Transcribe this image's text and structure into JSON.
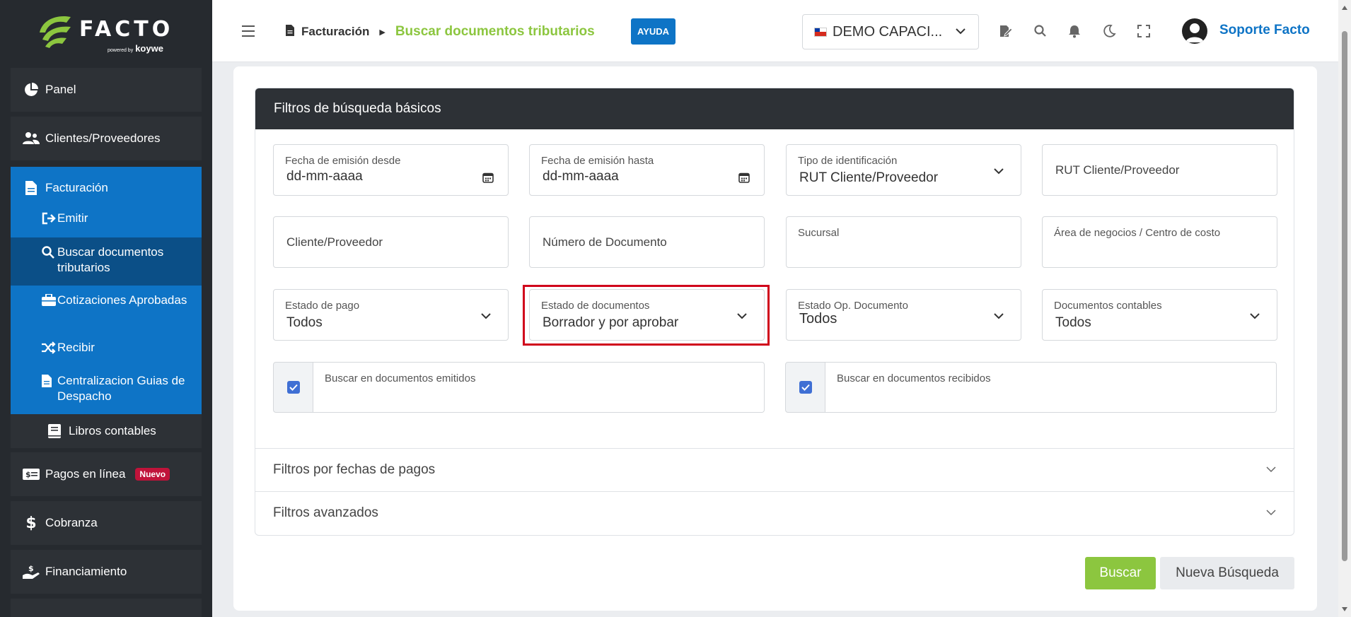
{
  "brand": {
    "name": "FACTO",
    "powered_small": "powered by",
    "powered": "koywe"
  },
  "sidebar": {
    "panel": "Panel",
    "clientes": "Clientes/Proveedores",
    "facturacion": "Facturación",
    "emitir": "Emitir",
    "buscar": "Buscar documentos tributarios",
    "cotizaciones": "Cotizaciones Aprobadas",
    "recibir": "Recibir",
    "centralizacion": "Centralizacion Guias de Despacho",
    "libros": "Libros contables",
    "pagos": "Pagos en línea",
    "pagos_badge": "Nuevo",
    "cobranza": "Cobranza",
    "financiamiento": "Financiamiento"
  },
  "header": {
    "crumb_parent": "Facturación",
    "crumb_current": "Buscar documentos tributarios",
    "help": "AYUDA",
    "company": "DEMO CAPACI...",
    "user": "Soporte Facto"
  },
  "filters": {
    "title": "Filtros de búsqueda básicos",
    "fecha_desde_label": "Fecha de emisión desde",
    "fecha_desde_value": "dd-mm-aaaa",
    "fecha_hasta_label": "Fecha de emisión hasta",
    "fecha_hasta_value": "dd-mm-aaaa",
    "tipo_id_label": "Tipo de identificación",
    "tipo_id_value": "RUT Cliente/Proveedor",
    "rut_placeholder": "RUT Cliente/Proveedor",
    "cliente_placeholder": "Cliente/Proveedor",
    "numero_placeholder": "Número de Documento",
    "sucursal_label": "Sucursal",
    "area_label": "Área de negocios / Centro de costo",
    "estado_pago_label": "Estado de pago",
    "estado_pago_value": "Todos",
    "estado_doc_label": "Estado de documentos",
    "estado_doc_value": "Borrador y por aprobar",
    "estado_op_label": "Estado Op. Documento",
    "estado_op_value": "Todos",
    "doc_contables_label": "Documentos contables",
    "doc_contables_value": "Todos",
    "emitidos_label": "Buscar en documentos emitidos",
    "recibidos_label": "Buscar en documentos recibidos"
  },
  "accordions": {
    "fechas_pagos": "Filtros por fechas de pagos",
    "avanzados": "Filtros avanzados"
  },
  "actions": {
    "buscar": "Buscar",
    "nueva": "Nueva Búsqueda"
  }
}
